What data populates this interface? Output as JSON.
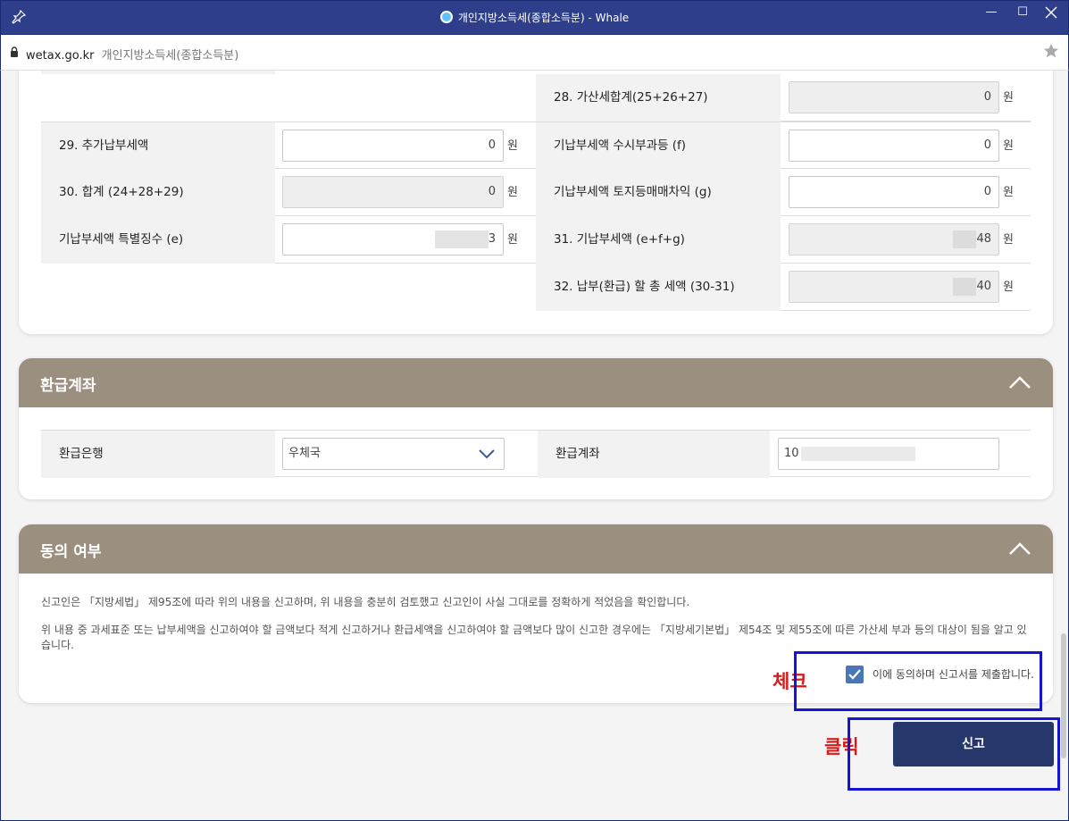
{
  "window": {
    "title": "개인지방소득세(종합소득분) - Whale",
    "minimize": "—",
    "maximize": "☐"
  },
  "address": {
    "url": "wetax.go.kr",
    "site_title": "개인지방소득세(종합소득분)"
  },
  "tax_table": {
    "unit": "원",
    "r28": {
      "label": "28. 가산세합계(25+26+27)",
      "value": "0"
    },
    "r29": {
      "label": "29. 추가납부세액",
      "value": "0"
    },
    "rf": {
      "label": "기납부세액 수시부과등 (f)",
      "value": "0"
    },
    "r30": {
      "label": "30. 합계 (24+28+29)",
      "value": "0"
    },
    "rg": {
      "label": "기납부세액 토지등매매차익 (g)",
      "value": "0"
    },
    "re": {
      "label": "기납부세액 특별징수 (e)",
      "value_suffix": "3"
    },
    "r31": {
      "label": "31. 기납부세액 (e+f+g)",
      "value_suffix": "48"
    },
    "r32": {
      "label": "32. 납부(환급) 할 총 세액 (30-31)",
      "value_suffix": "40"
    }
  },
  "refund": {
    "title": "환급계좌",
    "bank_label": "환급은행",
    "bank_value": "우체국",
    "account_label": "환급계좌",
    "account_prefix": "10"
  },
  "consent": {
    "title": "동의 여부",
    "notice1": "신고인은 「지방세법」 제95조에 따라 위의 내용을 신고하며, 위 내용을 충분히 검토했고 신고인이 사실 그대로를 정확하게 적었음을 확인합니다.",
    "notice2": "위 내용 중 과세표준 또는 납부세액을 신고하여야 할 금액보다 적게 신고하거나 환급세액을 신고하여야 할 금액보다 많이 신고한 경우에는 「지방세기본법」 제54조 및 제55조에 따른 가산세 부과 등의 대상이 됨을 알고 있습니다.",
    "agree_text": "이에 동의하며 신고서를 제출합니다.",
    "agree_checked": true
  },
  "annotations": {
    "check": "체크",
    "click": "클릭"
  },
  "submit": {
    "label": "신고"
  },
  "colors": {
    "titlebar": "#2e3e8a",
    "section_header": "#9b8f7f",
    "submit_button": "#26376b",
    "annotation_red": "#d61b1b",
    "annotation_box": "#1414d9",
    "checkbox": "#4a76b8"
  }
}
